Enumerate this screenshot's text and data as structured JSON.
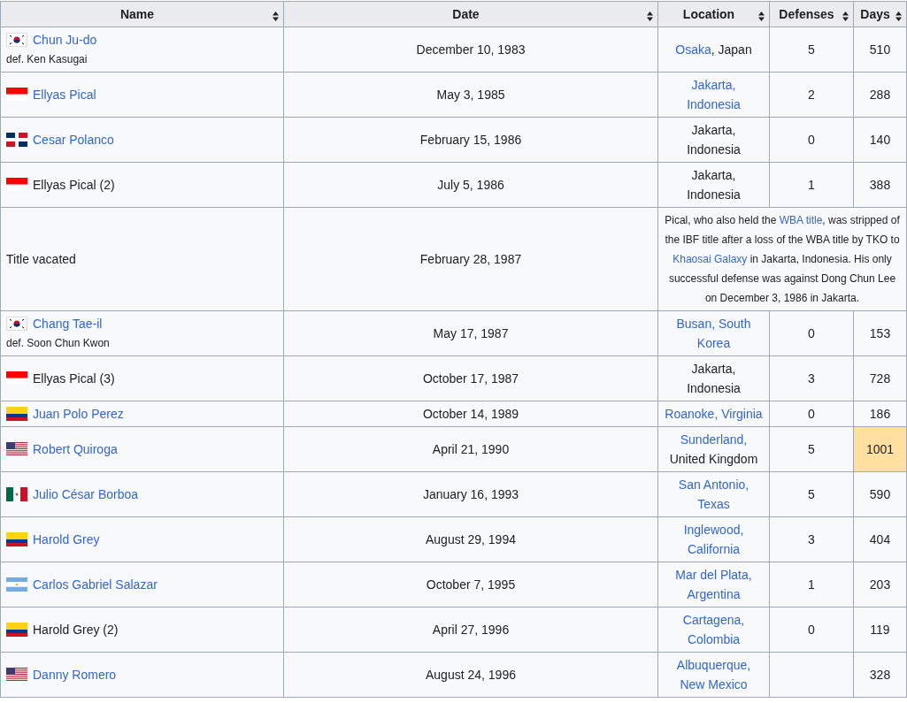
{
  "columns": [
    "Name",
    "Date",
    "Location",
    "Defenses",
    "Days"
  ],
  "rows": [
    {
      "flag": {
        "kind": "kr"
      },
      "name": "Chun Ju-do",
      "linked": true,
      "subtitle": "def. Ken Kasugai",
      "date": "December 10, 1983",
      "location": [
        {
          "text": "Osaka",
          "link": true
        },
        {
          "text": ", Japan",
          "link": false
        }
      ],
      "defenses": "5",
      "days": "510",
      "highlighted": false
    },
    {
      "flag": {
        "kind": "id"
      },
      "name": "Ellyas Pical",
      "linked": true,
      "date": "May 3, 1985",
      "location": [
        {
          "text": "Jakarta, Indonesia",
          "link": true
        }
      ],
      "defenses": "2",
      "days": "288",
      "highlighted": false
    },
    {
      "flag": {
        "kind": "do"
      },
      "name": "Cesar Polanco",
      "linked": true,
      "date": "February 15, 1986",
      "location": [
        {
          "text": "Jakarta, Indonesia",
          "link": false
        }
      ],
      "defenses": "0",
      "days": "140",
      "highlighted": false
    },
    {
      "flag": {
        "kind": "id"
      },
      "name": "Ellyas Pical (2)",
      "linked": false,
      "date": "July 5, 1986",
      "location": [
        {
          "text": "Jakarta, Indonesia",
          "link": false
        }
      ],
      "defenses": "1",
      "days": "388",
      "highlighted": false
    },
    {
      "kind": "note",
      "name": "Title vacated",
      "linked": false,
      "date": "February 28, 1987",
      "note": [
        {
          "text": "Pical, who also held the ",
          "link": false
        },
        {
          "text": "WBA title",
          "link": true
        },
        {
          "text": ", was stripped of the IBF title after a loss of the WBA title by TKO to ",
          "link": false
        },
        {
          "text": "Khaosai Galaxy",
          "link": true
        },
        {
          "text": " in Jakarta, Indonesia. His only successful defense was against Dong Chun Lee on December 3, 1986 in Jakarta.",
          "link": false
        }
      ]
    },
    {
      "flag": {
        "kind": "kr"
      },
      "name": "Chang Tae-il",
      "linked": true,
      "subtitle": "def. Soon Chun Kwon",
      "date": "May 17, 1987",
      "location": [
        {
          "text": "Busan, South Korea",
          "link": true
        }
      ],
      "defenses": "0",
      "days": "153",
      "highlighted": false
    },
    {
      "flag": {
        "kind": "id"
      },
      "name": "Ellyas Pical (3)",
      "linked": false,
      "date": "October 17, 1987",
      "location": [
        {
          "text": "Jakarta, Indonesia",
          "link": false
        }
      ],
      "defenses": "3",
      "days": "728",
      "highlighted": false
    },
    {
      "flag": {
        "kind": "co"
      },
      "name": "Juan Polo Perez",
      "linked": true,
      "date": "October 14, 1989",
      "location": [
        {
          "text": "Roanoke, Virginia",
          "link": true
        }
      ],
      "defenses": "0",
      "days": "186",
      "highlighted": false
    },
    {
      "flag": {
        "kind": "us"
      },
      "name": "Robert Quiroga",
      "linked": true,
      "date": "April 21, 1990",
      "location": [
        {
          "text": "Sunderland,",
          "link": true
        },
        {
          "text": " United Kingdom",
          "link": false
        }
      ],
      "defenses": "5",
      "days": "1001",
      "highlighted": true
    },
    {
      "flag": {
        "kind": "mx"
      },
      "name": "Julio César Borboa",
      "linked": true,
      "date": "January 16, 1993",
      "location": [
        {
          "text": "San Antonio, Texas",
          "link": true
        }
      ],
      "defenses": "5",
      "days": "590",
      "highlighted": false
    },
    {
      "flag": {
        "kind": "co"
      },
      "name": "Harold Grey",
      "linked": true,
      "date": "August 29, 1994",
      "location": [
        {
          "text": "Inglewood, California",
          "link": true
        }
      ],
      "defenses": "3",
      "days": "404",
      "highlighted": false
    },
    {
      "flag": {
        "kind": "ar"
      },
      "name": "Carlos Gabriel Salazar",
      "linked": true,
      "date": "October 7, 1995",
      "location": [
        {
          "text": "Mar del Plata, Argentina",
          "link": true
        }
      ],
      "defenses": "1",
      "days": "203",
      "highlighted": false
    },
    {
      "flag": {
        "kind": "co"
      },
      "name": "Harold Grey (2)",
      "linked": false,
      "date": "April 27, 1996",
      "location": [
        {
          "text": "Cartagena, Colombia",
          "link": true
        }
      ],
      "defenses": "0",
      "days": "119",
      "highlighted": false
    },
    {
      "flag": {
        "kind": "us"
      },
      "name": "Danny Romero",
      "linked": true,
      "date": "August 24, 1996",
      "location": [
        {
          "text": "Albuquerque, New Mexico",
          "link": true
        }
      ],
      "days": "328",
      "highlighted": false
    }
  ]
}
